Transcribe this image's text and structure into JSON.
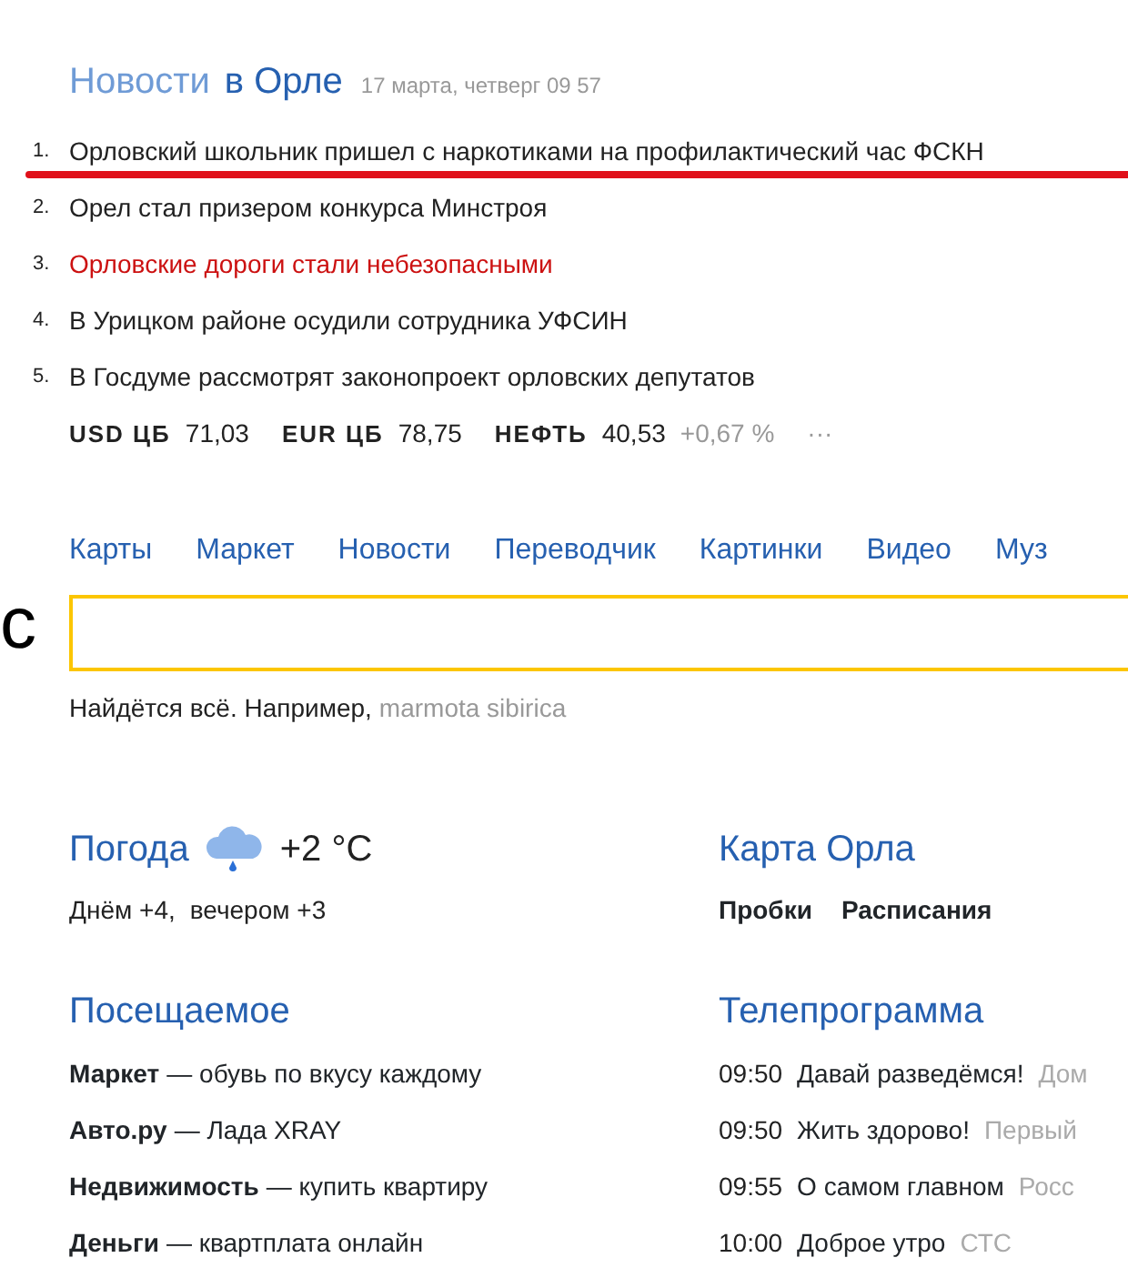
{
  "news": {
    "title": "Новости",
    "region": "в Орле",
    "date": "17 марта, четверг 09 57",
    "items": [
      {
        "number": "1.",
        "text": "Орловский школьник пришел с наркотиками на профилактический час ФСКН",
        "color": "#222222",
        "underlined": true
      },
      {
        "number": "2.",
        "text": "Орел стал призером конкурса Минстроя",
        "color": "#222222",
        "underlined": false
      },
      {
        "number": "3.",
        "text": "Орловские дороги стали небезопасными",
        "color": "#cc1111",
        "underlined": false
      },
      {
        "number": "4.",
        "text": "В Урицком районе осудили сотрудника УФСИН",
        "color": "#222222",
        "underlined": false
      },
      {
        "number": "5.",
        "text": "В Госдуме рассмотрят законопроект орловских депутатов",
        "color": "#222222",
        "underlined": false
      }
    ],
    "rates": [
      {
        "label": "USD ЦБ",
        "value": "71,03"
      },
      {
        "label": "EUR ЦБ",
        "value": "78,75"
      },
      {
        "label": "НЕФТЬ",
        "value": "40,53",
        "change": "+0,67 %"
      }
    ],
    "more": "···"
  },
  "services": [
    "Карты",
    "Маркет",
    "Новости",
    "Переводчик",
    "Картинки",
    "Видео",
    "Муз"
  ],
  "logo_text": "с",
  "search": {
    "hint": "Найдётся всё. Например,",
    "example": "marmota sibirica"
  },
  "weather": {
    "title": "Погода",
    "temperature": "+2 °C",
    "forecast": [
      "Днём +4,",
      "вечером +3"
    ]
  },
  "map": {
    "title": "Карта Орла",
    "links": [
      "Пробки",
      "Расписания"
    ]
  },
  "visited": {
    "title": "Посещаемое",
    "items": [
      {
        "name": "Маркет",
        "text": "— обувь по вкусу каждому"
      },
      {
        "name": "Авто.ру",
        "text": "— Лада XRAY"
      },
      {
        "name": "Недвижимость",
        "text": "— купить квартиру"
      },
      {
        "name": "Деньги",
        "text": "— квартплата онлайн"
      }
    ]
  },
  "tv": {
    "title": "Телепрограмма",
    "items": [
      {
        "time": "09:50",
        "show": "Давай разведёмся!",
        "channel": "Дом"
      },
      {
        "time": "09:50",
        "show": "Жить здорово!",
        "channel": "Первый"
      },
      {
        "time": "09:55",
        "show": "О самом главном",
        "channel": "Росс"
      },
      {
        "time": "10:00",
        "show": "Доброе утро",
        "channel": "СТС"
      }
    ]
  }
}
